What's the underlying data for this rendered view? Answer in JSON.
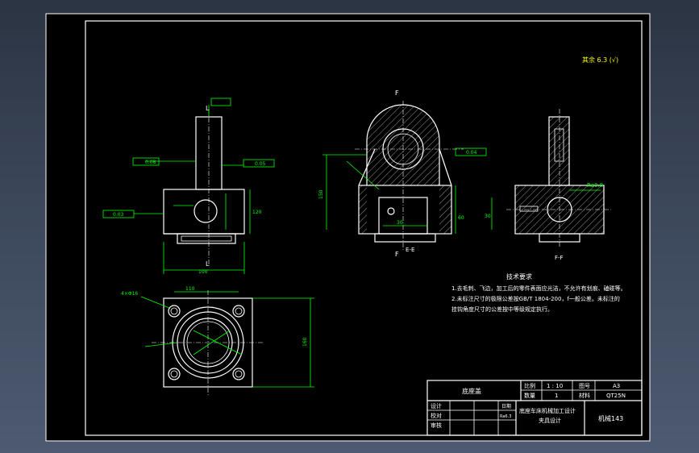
{
  "title_block": {
    "part_name": "底座盖",
    "scale_label": "比例",
    "scale_value": "1 : 10",
    "qty_label": "数量",
    "qty_value": "1",
    "drawing_no_label": "图号",
    "drawing_no_value": "A3",
    "material_label": "材料",
    "material_value": "QT25N",
    "design_label": "设计",
    "check_label": "校对",
    "review_label": "审核",
    "date_label": "日期",
    "school_name": "底座车床机械加工设计",
    "program_label": "夹具设计",
    "class_label": "机械143",
    "ref_text": "Ra6.3"
  },
  "notes": {
    "heading": "技术要求",
    "line1": "1.去毛刺、飞边，加工后的零件表面应光洁，不允许有划痕、磕碰等。",
    "line2": "2.未标注尺寸的极限公差按GB/T 1804-200，f一般公差。未标注的",
    "line3": "挂钩角度尺寸的公差按中等级规定执行。"
  },
  "roughness_note": "其余 6.3 (√)",
  "labels": {
    "section_ee": "E-E",
    "section_ff": "F-F",
    "section_marker_l": "L",
    "section_marker_f": "F",
    "ra_right": "Ra0.8",
    "dim_180": "180",
    "dim_160": "160",
    "dim_150": "150",
    "dim_120": "120",
    "dim_110": "110",
    "dim_100": "100",
    "dim_60": "60",
    "dim_30": "30",
    "dim_4x": "4×Φ16",
    "tol_a": "0.08",
    "tol_b": "0.03",
    "tol_c": "0.05",
    "tol_d": "0.04"
  }
}
